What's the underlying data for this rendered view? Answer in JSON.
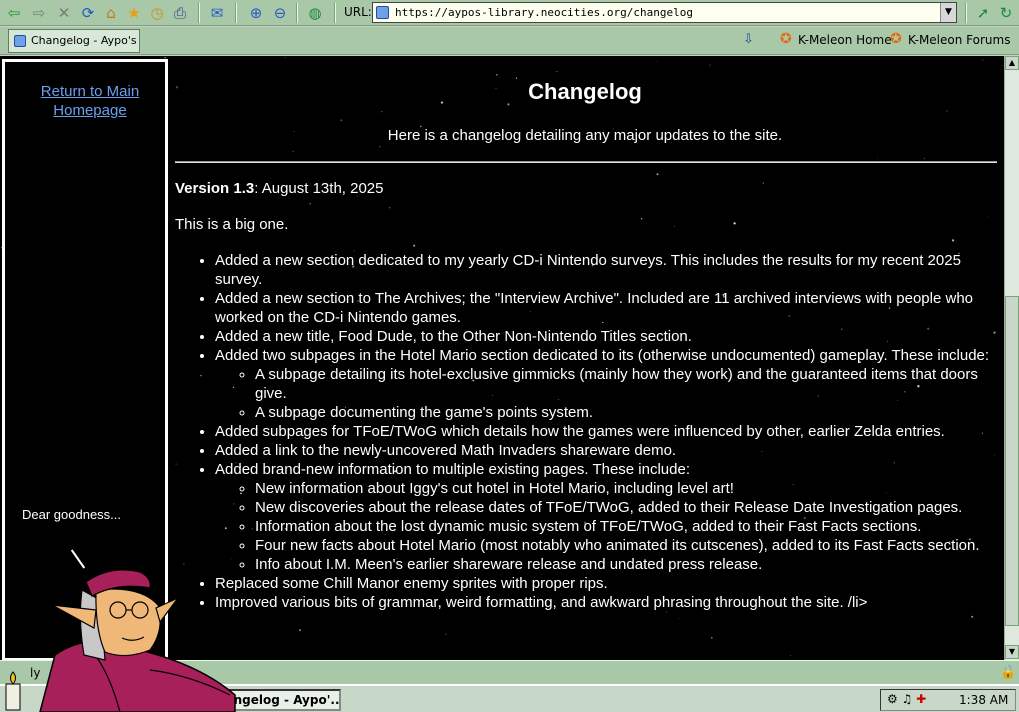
{
  "browser": {
    "url_label": "URL:",
    "url": "https://aypos-library.neocities.org/changelog",
    "tab_title": "Changelog - Aypo's ...",
    "bookmarks": [
      "K-Meleon Home",
      "K-Meleon Forums"
    ],
    "status": "ly",
    "icons": [
      "back-icon",
      "forward-icon",
      "stop-icon",
      "reload-icon",
      "home-icon",
      "bookmark-icon",
      "history-icon",
      "print-icon",
      "mail-icon",
      "zoom-in-icon",
      "zoom-out-icon",
      "globe-icon",
      "go-icon",
      "refresh-icon"
    ]
  },
  "sidebar": {
    "return_link": "Return to Main Homepage",
    "speech": "Dear goodness..."
  },
  "page": {
    "title": "Changelog",
    "subtitle": "Here is a changelog detailing any major updates to the site.",
    "version": "Version 1.3",
    "version_date": ": August 13th, 2025",
    "intro": "This is a big one.",
    "changes": [
      "Added a new section dedicated to my yearly CD-i Nintendo surveys. This includes the results for my recent 2025 survey.",
      "Added a new section to The Archives; the \"Interview Archive\". Included are 11 archived interviews with people who worked on the CD-i Nintendo games.",
      "Added a new title, Food Dude, to the Other Non-Nintendo Titles section.",
      "Added two subpages in the Hotel Mario section dedicated to its (otherwise undocumented) gameplay. These include:",
      "Added subpages for TFoE/TWoG which details how the games were influenced by other, earlier Zelda entries.",
      "Added a link to the newly-uncovered Math Invaders shareware demo.",
      "Added brand-new information to multiple existing pages. These include:",
      "Replaced some Chill Manor enemy sprites with proper rips.",
      "Improved various bits of grammar, weird formatting, and awkward phrasing throughout the site. /li>"
    ],
    "hotel_subitems": [
      "A subpage detailing its hotel-exclusive gimmicks (mainly how they work) and the guaranteed items that doors give.",
      "A subpage documenting the game's points system."
    ],
    "info_subitems": [
      "New information about Iggy's cut hotel in Hotel Mario, including level art!",
      "New discoveries about the release dates of TFoE/TWoG, added to their Release Date Investigation pages.",
      "Information about the lost dynamic music system of TFoE/TWoG, added to their Fast Facts sections.",
      "Four new facts about Hotel Mario (most notably who animated its cutscenes), added to its Fast Facts section.",
      "Info about I.M. Meen's earlier shareware release and undated press release."
    ]
  },
  "taskbar": {
    "task_label": "hangelog - Aypo'...",
    "clock": "1:38 AM"
  }
}
